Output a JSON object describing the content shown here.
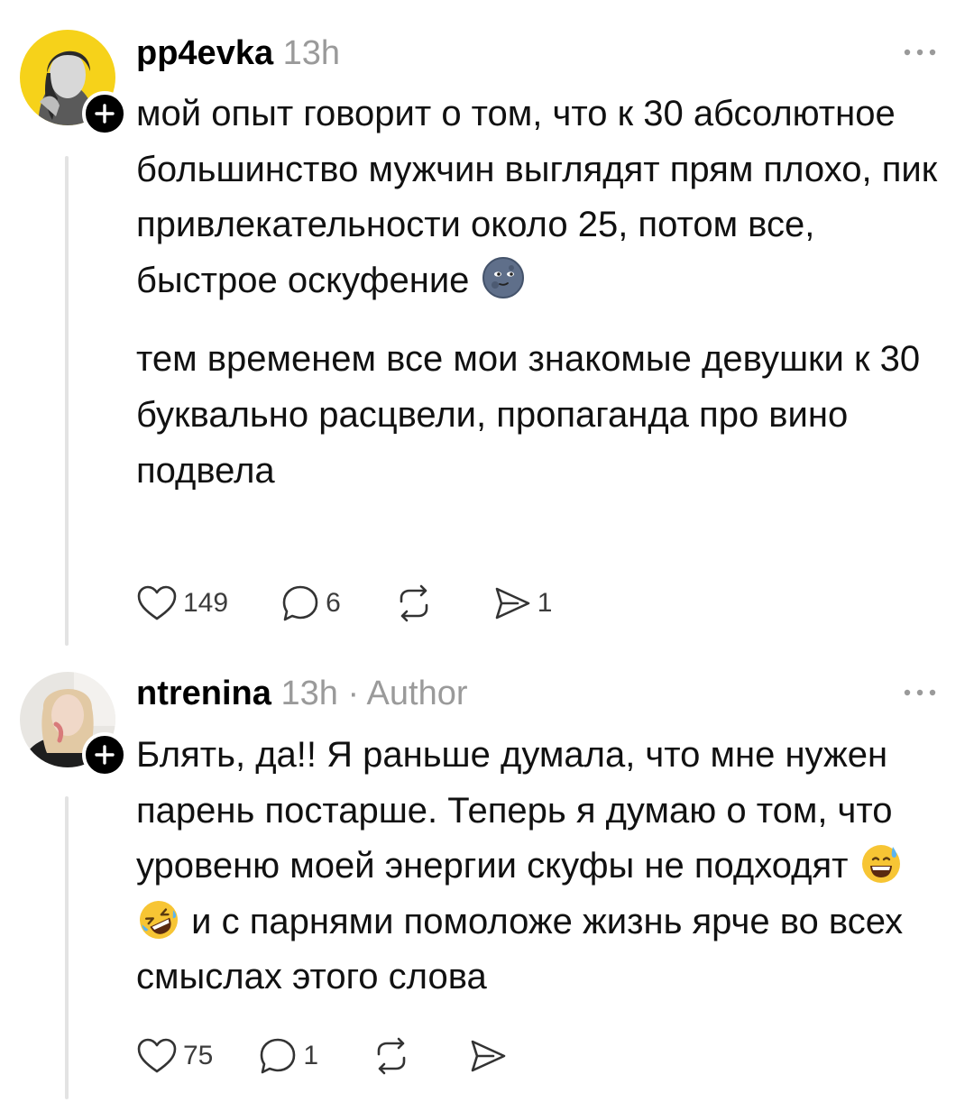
{
  "posts": [
    {
      "username": "pp4evka",
      "time": "13h",
      "author_badge": "",
      "paragraphs": [
        "мой опыт говорит о том, что к 30 абсолютное большинство мужчин выглядят прям плохо, пик привлекательности около 25, потом все, быстрое оскуфение",
        "тем временем все мои знакомые девушки к 30 буквально расцвели, пропаганда про вино подвела"
      ],
      "emoji_after_p1": "new-moon-face-emoji",
      "likes": "149",
      "replies": "6",
      "reposts": "",
      "shares": "1"
    },
    {
      "username": "ntrenina",
      "time": "13h",
      "author_badge": "· Author",
      "text_before_emoji": "Блять, да!! Я раньше думала, что мне нужен парень постарше. Теперь я думаю о том, что уровеню моей энергии скуфы не подходят",
      "text_after_emoji": "и с парнями помоложе жизнь ярче во всех смыслах этого слова",
      "emojis": [
        "grinning-sweat-emoji",
        "rolling-on-floor-laughing-emoji"
      ],
      "likes": "75",
      "replies": "1",
      "reposts": "",
      "shares": ""
    }
  ],
  "icons": {
    "like": "heart-icon",
    "reply": "comment-bubble-icon",
    "repost": "repost-arrows-icon",
    "share": "paper-plane-icon",
    "more": "more-dots-icon",
    "follow": "plus-icon"
  },
  "colors": {
    "meta": "#9a9a9a",
    "badge": "#000000",
    "line": "#e3e3e3"
  }
}
